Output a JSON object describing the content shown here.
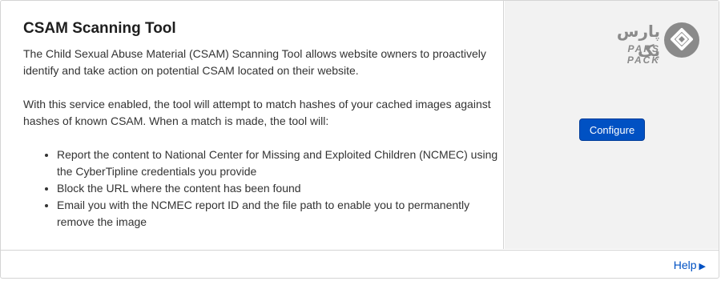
{
  "card": {
    "title": "CSAM Scanning Tool",
    "intro": "The Child Sexual Abuse Material (CSAM) Scanning Tool allows website owners to proactively identify and take action on potential CSAM located on their website.",
    "description": "With this service enabled, the tool will attempt to match hashes of your cached images against hashes of known CSAM. When a match is made, the tool will:",
    "actions": [
      "Report the content to National Center for Missing and Exploited Children (NCMEC) using the CyberTipline credentials you provide",
      "Block the URL where the content has been found",
      "Email you with the NCMEC report ID and the file path to enable you to permanently remove the image"
    ]
  },
  "side": {
    "configure_label": "Configure"
  },
  "watermark": {
    "arabic": "پارس پک",
    "latin": "PARS PACK"
  },
  "footer": {
    "help_label": "Help",
    "help_arrow": "▶"
  },
  "colors": {
    "accent": "#0051c3",
    "side_bg": "#f2f2f2",
    "border": "#d4d4d4"
  },
  "icons": {
    "logo_mark": "pars-pack-logo-icon",
    "help_arrow": "triangle-right-icon"
  }
}
